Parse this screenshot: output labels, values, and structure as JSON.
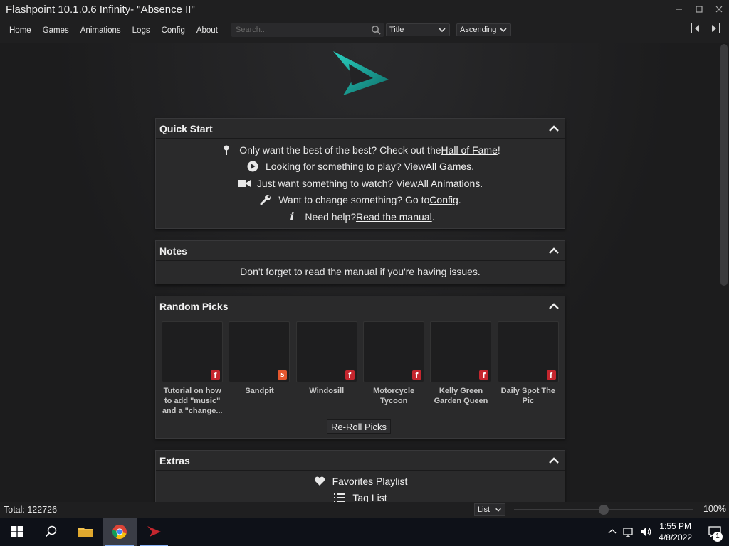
{
  "window": {
    "title": "Flashpoint 10.1.0.6 Infinity- \"Absence II\""
  },
  "menu": {
    "items": [
      "Home",
      "Games",
      "Animations",
      "Logs",
      "Config",
      "About"
    ]
  },
  "search": {
    "placeholder": "Search..."
  },
  "sort": {
    "field": "Title",
    "order": "Ascending"
  },
  "quick_start": {
    "title": "Quick Start",
    "lines": [
      {
        "pre": "Only want the best of the best? Check out the ",
        "link": "Hall of Fame",
        "post": "!"
      },
      {
        "pre": "Looking for something to play? View ",
        "link": "All Games",
        "post": "."
      },
      {
        "pre": "Just want something to watch? View ",
        "link": "All Animations",
        "post": "."
      },
      {
        "pre": "Want to change something? Go to ",
        "link": "Config",
        "post": "."
      },
      {
        "pre": "Need help? ",
        "link": "Read the manual",
        "post": "."
      }
    ]
  },
  "notes": {
    "title": "Notes",
    "text": "Don't forget to read the manual if you're having issues."
  },
  "random_picks": {
    "title": "Random Picks",
    "items": [
      {
        "title": "Tutorial on how to add \"music\" and a \"change...",
        "platform": "flash"
      },
      {
        "title": "Sandpit",
        "platform": "html5"
      },
      {
        "title": "Windosill",
        "platform": "flash"
      },
      {
        "title": "Motorcycle Tycoon",
        "platform": "flash"
      },
      {
        "title": "Kelly Green Garden Queen",
        "platform": "flash"
      },
      {
        "title": "Daily Spot The Pic",
        "platform": "flash"
      }
    ],
    "reroll_label": "Re-Roll Picks"
  },
  "extras": {
    "title": "Extras",
    "items": [
      "Favorites Playlist",
      "Tag List"
    ]
  },
  "status": {
    "total": "Total: 122726",
    "view": "List",
    "zoom": "100%",
    "zoom_level": 0.5
  },
  "taskbar": {
    "time": "1:55 PM",
    "date": "4/8/2022",
    "notifications": "1"
  },
  "colors": {
    "accent": "#1fb9a8",
    "flash_badge": "#c4262e",
    "html5_badge": "#e4572e"
  }
}
